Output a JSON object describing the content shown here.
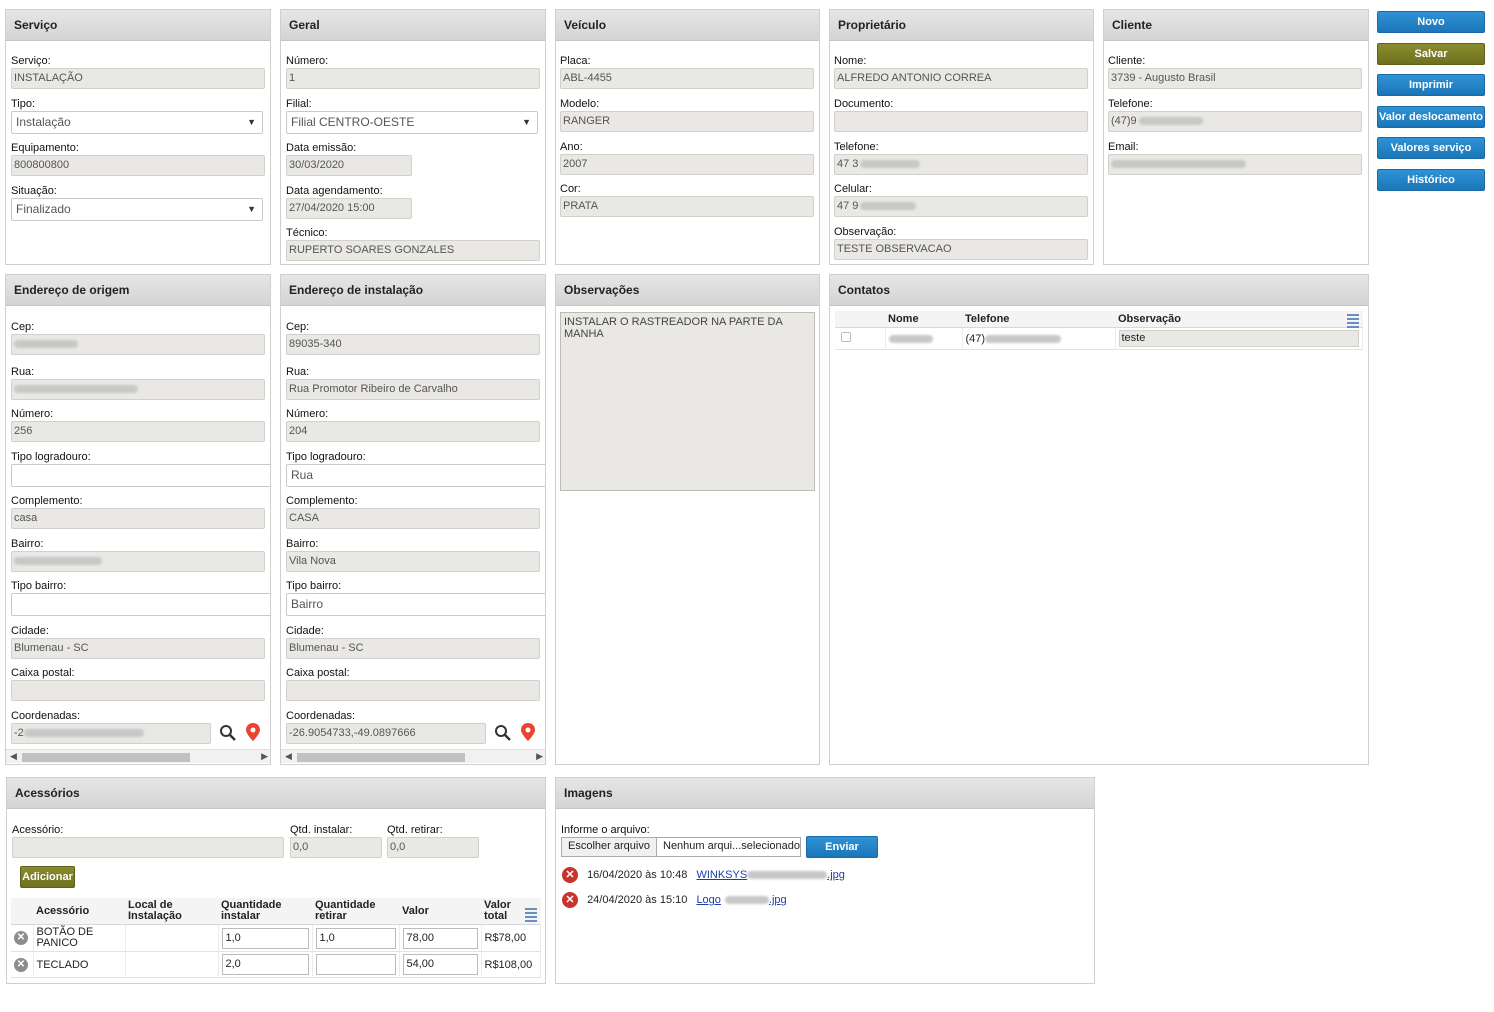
{
  "servico": {
    "title": "Serviço",
    "servico_label": "Serviço:",
    "servico_value": "INSTALAÇÃO",
    "tipo_label": "Tipo:",
    "tipo_value": "Instalação",
    "equipamento_label": "Equipamento:",
    "equipamento_value": "800800800",
    "situacao_label": "Situação:",
    "situacao_value": "Finalizado"
  },
  "geral": {
    "title": "Geral",
    "numero_label": "Número:",
    "numero_value": "1",
    "filial_label": "Filial:",
    "filial_value": "Filial CENTRO-OESTE",
    "emissao_label": "Data emissão:",
    "emissao_value": "30/03/2020",
    "agendamento_label": "Data agendamento:",
    "agendamento_value": "27/04/2020 15:00",
    "tecnico_label": "Técnico:",
    "tecnico_value": "RUPERTO SOARES GONZALES"
  },
  "veiculo": {
    "title": "Veículo",
    "placa_label": "Placa:",
    "placa_value": "ABL-4455",
    "modelo_label": "Modelo:",
    "modelo_value": "RANGER",
    "ano_label": "Ano:",
    "ano_value": "2007",
    "cor_label": "Cor:",
    "cor_value": "PRATA"
  },
  "proprietario": {
    "title": "Proprietário",
    "nome_label": "Nome:",
    "nome_value": "ALFREDO ANTONIO CORREA",
    "documento_label": "Documento:",
    "documento_value": "",
    "telefone_label": "Telefone:",
    "telefone_value": "47 3",
    "celular_label": "Celular:",
    "celular_value": "47 9",
    "observacao_label": "Observação:",
    "observacao_value": "TESTE OBSERVACAO"
  },
  "cliente": {
    "title": "Cliente",
    "cliente_label": "Cliente:",
    "cliente_value": "3739 - Augusto Brasil",
    "telefone_label": "Telefone:",
    "telefone_value": "(47)9",
    "email_label": "Email:",
    "email_value": ""
  },
  "actions": {
    "novo": "Novo",
    "salvar": "Salvar",
    "imprimir": "Imprimir",
    "valor_deslocamento": "Valor deslocamento",
    "valores_servico": "Valores serviço",
    "historico": "Histórico"
  },
  "origem": {
    "title": "Endereço de origem",
    "cep_label": "Cep:",
    "rua_label": "Rua:",
    "numero_label": "Número:",
    "numero_value": "256",
    "tipo_logradouro_label": "Tipo logradouro:",
    "tipo_logradouro_value": "",
    "complemento_label": "Complemento:",
    "complemento_value": "casa",
    "bairro_label": "Bairro:",
    "tipo_bairro_label": "Tipo bairro:",
    "tipo_bairro_value": "",
    "cidade_label": "Cidade:",
    "cidade_value": "Blumenau - SC",
    "caixa_label": "Caixa postal:",
    "caixa_value": "",
    "coord_label": "Coordenadas:",
    "coord_value": "-2"
  },
  "instalacao": {
    "title": "Endereço de instalação",
    "cep_label": "Cep:",
    "cep_value": "89035-340",
    "rua_label": "Rua:",
    "rua_value": "Rua Promotor Ribeiro de Carvalho",
    "numero_label": "Número:",
    "numero_value": "204",
    "tipo_logradouro_label": "Tipo logradouro:",
    "tipo_logradouro_value": "Rua",
    "complemento_label": "Complemento:",
    "complemento_value": "CASA",
    "bairro_label": "Bairro:",
    "bairro_value": "Vila Nova",
    "tipo_bairro_label": "Tipo bairro:",
    "tipo_bairro_value": "Bairro",
    "cidade_label": "Cidade:",
    "cidade_value": "Blumenau - SC",
    "caixa_label": "Caixa postal:",
    "caixa_value": "",
    "coord_label": "Coordenadas:",
    "coord_value": "-26.9054733,-49.0897666"
  },
  "observacoes": {
    "title": "Observações",
    "text": "INSTALAR O RASTREADOR NA PARTE DA MANHA"
  },
  "contatos": {
    "title": "Contatos",
    "col_nome": "Nome",
    "col_telefone": "Telefone",
    "col_observacao": "Observação",
    "row_telefone": "(47)",
    "row_observacao": "teste"
  },
  "acessorios": {
    "title": "Acessórios",
    "acessorio_label": "Acessório:",
    "qtd_instalar_label": "Qtd. instalar:",
    "qtd_retirar_label": "Qtd. retirar:",
    "qtd_instalar_value": "0,0",
    "qtd_retirar_value": "0,0",
    "adicionar": "Adicionar",
    "headers": [
      "Acessório",
      "Local de Instalação",
      "Quantidade instalar",
      "Quantidade retirar",
      "Valor",
      "Valor total"
    ],
    "rows": [
      {
        "acessorio": "BOTÃO DE PANICO",
        "local": "",
        "qtd_instalar": "1,0",
        "qtd_retirar": "1,0",
        "valor": "78,00",
        "total": "R$78,00"
      },
      {
        "acessorio": "TECLADO",
        "local": "",
        "qtd_instalar": "2,0",
        "qtd_retirar": "",
        "valor": "54,00",
        "total": "R$108,00"
      }
    ]
  },
  "imagens": {
    "title": "Imagens",
    "informe_label": "Informe o arquivo:",
    "escolher": "Escolher arquivo",
    "nenhum": "Nenhum arqui...selecionado",
    "enviar": "Enviar",
    "files": [
      {
        "date": "16/04/2020 às 10:48",
        "name_start": "WINKSYS",
        "name_end": ".jpg"
      },
      {
        "date": "24/04/2020 às 15:10",
        "name_start": "Logo",
        "name_end": ".jpg"
      }
    ]
  }
}
